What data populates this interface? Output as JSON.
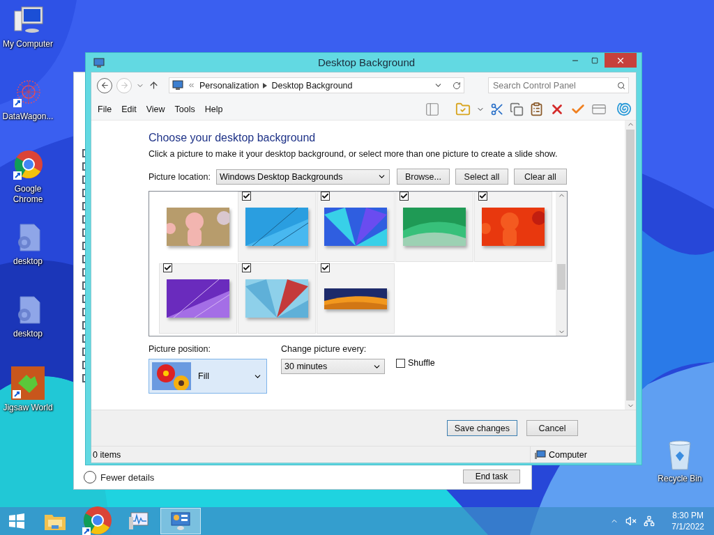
{
  "desktop_icons": [
    {
      "label": "My Computer",
      "kind": "computer"
    },
    {
      "label": "DataWagon...",
      "kind": "network"
    },
    {
      "label": "Google Chrome",
      "kind": "chrome"
    },
    {
      "label": "desktop",
      "kind": "settings-file"
    },
    {
      "label": "desktop",
      "kind": "settings-file"
    },
    {
      "label": "Jigsaw World",
      "kind": "puzzle"
    }
  ],
  "recycle_bin": {
    "label": "Recycle Bin"
  },
  "back_window": {
    "details_link": "Fewer details",
    "end_task": "End task"
  },
  "window": {
    "title": "Desktop Background",
    "breadcrumbs": [
      "Personalization",
      "Desktop Background"
    ],
    "search": {
      "placeholder": "Search Control Panel"
    },
    "menu": [
      "File",
      "Edit",
      "View",
      "Tools",
      "Help"
    ],
    "heading": "Choose your desktop background",
    "description": "Click a picture to make it your desktop background, or select more than one picture to create a slide show.",
    "picture_location": {
      "label": "Picture location:",
      "value": "Windows Desktop Backgrounds"
    },
    "location_buttons": [
      "Browse...",
      "Select all",
      "Clear all"
    ],
    "pictures": [
      {
        "checked": false
      },
      {
        "checked": true
      },
      {
        "checked": true
      },
      {
        "checked": true
      },
      {
        "checked": true
      },
      {
        "checked": true
      },
      {
        "checked": true
      },
      {
        "checked": true
      }
    ],
    "position": {
      "label": "Picture position:",
      "value": "Fill"
    },
    "interval": {
      "label": "Change picture every:",
      "value": "30 minutes"
    },
    "shuffle": {
      "label": "Shuffle",
      "checked": false
    },
    "actions": [
      "Save changes",
      "Cancel"
    ],
    "status": {
      "items": "0 items",
      "location": "Computer"
    }
  },
  "taskbar": {
    "apps": [
      {
        "kind": "explorer",
        "selected": false
      },
      {
        "kind": "chrome",
        "selected": false
      },
      {
        "kind": "monitor",
        "selected": false
      },
      {
        "kind": "control-panel",
        "selected": true
      }
    ],
    "clock": {
      "time": "8:30 PM",
      "date": "7/1/2022"
    }
  }
}
